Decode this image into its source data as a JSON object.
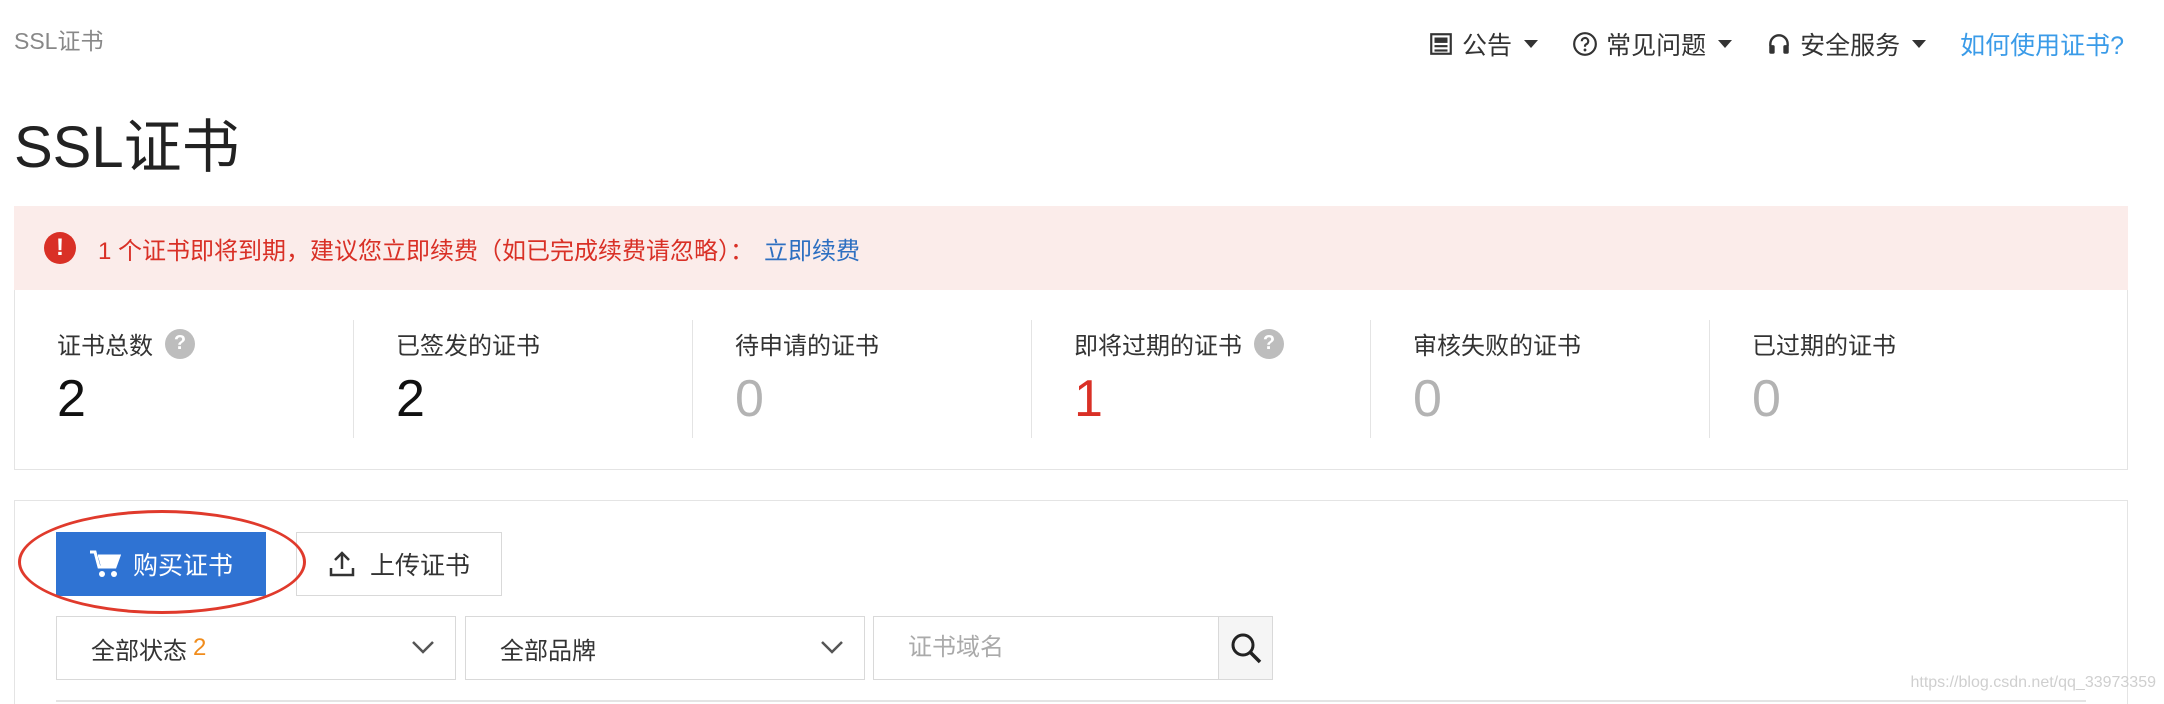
{
  "breadcrumb": "SSL证书",
  "top_nav": {
    "announcement": "公告",
    "faq": "常见问题",
    "security_service": "安全服务",
    "help_link": "如何使用证书?"
  },
  "page_title": "SSL证书",
  "alert": {
    "icon": "!",
    "text": "1 个证书即将到期，建议您立即续费（如已完成续费请忽略）：",
    "link": "立即续费"
  },
  "stats": [
    {
      "label": "证书总数",
      "value": "2",
      "help": true,
      "tone": "dark"
    },
    {
      "label": "已签发的证书",
      "value": "2",
      "help": false,
      "tone": "dark"
    },
    {
      "label": "待申请的证书",
      "value": "0",
      "help": false,
      "tone": "muted"
    },
    {
      "label": "即将过期的证书",
      "value": "1",
      "help": true,
      "tone": "red"
    },
    {
      "label": "审核失败的证书",
      "value": "0",
      "help": false,
      "tone": "muted"
    },
    {
      "label": "已过期的证书",
      "value": "0",
      "help": false,
      "tone": "muted"
    }
  ],
  "help_glyph": "?",
  "toolbar": {
    "buy_label": "购买证书",
    "upload_label": "上传证书"
  },
  "filters": {
    "status_label": "全部状态",
    "status_count": "2",
    "brand_label": "全部品牌",
    "search_placeholder": "证书域名"
  },
  "watermark": "https://blog.csdn.net/qq_33973359",
  "colors": {
    "primary": "#2f73d3",
    "alert_bg": "#fbecea",
    "alert_text": "#d93026",
    "link": "#2d6fc1",
    "highlight": "#e03a2c",
    "count": "#f08c1c"
  }
}
